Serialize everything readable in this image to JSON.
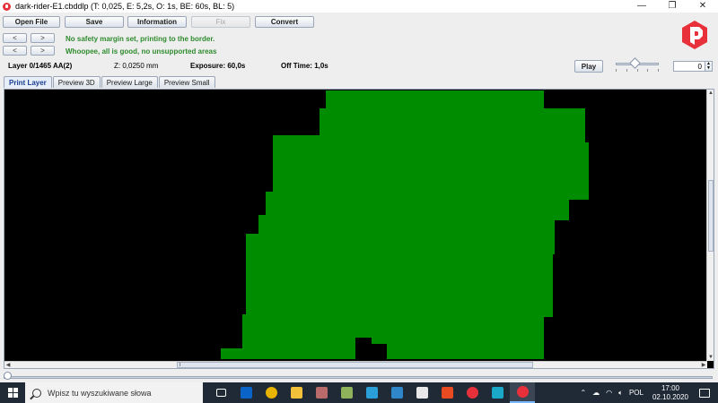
{
  "window": {
    "title": "dark-rider-E1.cbddlp (T: 0,025, E: 5,2s, O: 1s, BE: 60s, BL: 5)",
    "controls": {
      "minimize": "—",
      "maximize": "❐",
      "close": "✕"
    }
  },
  "toolbar": {
    "open_file": "Open File",
    "save": "Save",
    "information": "Information",
    "fix": "Fix",
    "convert": "Convert"
  },
  "status": {
    "prev1": "<",
    "next1": ">",
    "message1": "No safety margin set, printing to the border.",
    "prev2": "<",
    "next2": ">",
    "message2": "Whoopee, all is good, no unsupported areas"
  },
  "layer_info": {
    "layer": "Layer 0/1465 AA(2)",
    "z": "Z: 0,0250 mm",
    "exposure": "Exposure: 60,0s",
    "off_time": "Off Time: 1,0s"
  },
  "playback": {
    "play_label": "Play",
    "speed_slider_level": 0.45,
    "spinner_value": "0"
  },
  "tabs": [
    {
      "label": "Print Layer",
      "active": true
    },
    {
      "label": "Preview 3D",
      "active": false
    },
    {
      "label": "Preview Large",
      "active": false
    },
    {
      "label": "Preview Small",
      "active": false
    }
  ],
  "layer_view": {
    "background_color": "#000000",
    "fill_color": "#008c00"
  },
  "layer_slider": {
    "value": 0
  },
  "taskbar": {
    "search_placeholder": "Wpisz tu wyszukiwane słowa",
    "language": "POL",
    "time": "17:00",
    "date": "02.10.2020",
    "apps": [
      {
        "name": "task-view-icon",
        "color": "#ffffff"
      },
      {
        "name": "outlook-icon",
        "color": "#0a64c8"
      },
      {
        "name": "chrome-icon",
        "color": "#e8b400"
      },
      {
        "name": "file-explorer-icon",
        "color": "#f3c13a"
      },
      {
        "name": "app-icon-5",
        "color": "#b96b6b"
      },
      {
        "name": "app-icon-6",
        "color": "#8fb35a"
      },
      {
        "name": "app-icon-7",
        "color": "#2a9fd8"
      },
      {
        "name": "app-icon-8",
        "color": "#2f86c9"
      },
      {
        "name": "app-icon-9",
        "color": "#e8e8e8"
      },
      {
        "name": "office-icon",
        "color": "#e84a22"
      },
      {
        "name": "chitubox-icon",
        "color": "#e8303a"
      },
      {
        "name": "app-icon-12",
        "color": "#19a8c7"
      },
      {
        "name": "photon-icon",
        "color": "#e8303a"
      }
    ]
  }
}
